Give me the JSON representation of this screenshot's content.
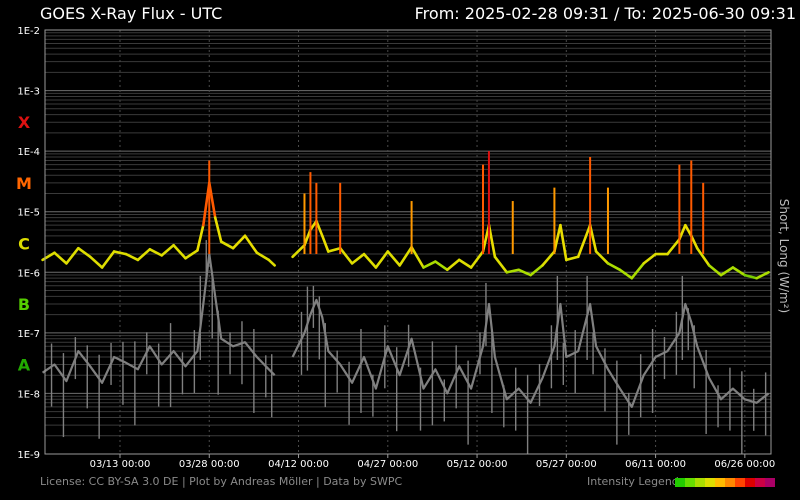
{
  "header": {
    "title": "GOES X-Ray Flux - UTC",
    "range": "From: 2025-02-28 09:31  /  To: 2025-06-30 09:31"
  },
  "footer": {
    "license": "License: CC BY-SA 3.0 DE | Plot by Andreas Möller | Data by SWPC",
    "legend_label": "Intensity Legend",
    "legend_colors": [
      "#22cc00",
      "#66dd00",
      "#aadd00",
      "#dddd00",
      "#ffbb00",
      "#ff8800",
      "#ff4400",
      "#dd0000",
      "#cc0044",
      "#aa0066"
    ]
  },
  "chart_data": {
    "type": "line",
    "title": "GOES X-Ray Flux - UTC",
    "ylabel": "Short, Long (W/m²)",
    "y_scale": "log",
    "ylim": [
      1e-09,
      0.01
    ],
    "y_ticks": [
      {
        "value": 0.01,
        "label": "1E-2"
      },
      {
        "value": 0.001,
        "label": "1E-3"
      },
      {
        "value": 0.0001,
        "label": "1E-4"
      },
      {
        "value": 1e-05,
        "label": "1E-5"
      },
      {
        "value": 1e-06,
        "label": "1E-6"
      },
      {
        "value": 1e-07,
        "label": "1E-7"
      },
      {
        "value": 1e-08,
        "label": "1E-8"
      },
      {
        "value": 1e-09,
        "label": "1E-9"
      }
    ],
    "flare_classes": [
      {
        "label": "X",
        "value": 0.0003,
        "color": "#dd1111"
      },
      {
        "label": "M",
        "value": 3e-05,
        "color": "#ff6600"
      },
      {
        "label": "C",
        "value": 3e-06,
        "color": "#dddd00"
      },
      {
        "label": "B",
        "value": 3e-07,
        "color": "#55cc00"
      },
      {
        "label": "A",
        "value": 3e-08,
        "color": "#22aa00"
      }
    ],
    "xlim": [
      "2025-02-28 09:31",
      "2025-06-30 09:31"
    ],
    "x_ticks": [
      "03/13 00:00",
      "03/28 00:00",
      "04/12 00:00",
      "04/27 00:00",
      "05/12 00:00",
      "05/27 00:00",
      "06/11 00:00",
      "06/26 00:00"
    ],
    "x_tick_dates": [
      "2025-03-13",
      "2025-03-28",
      "2025-04-12",
      "2025-04-27",
      "2025-05-12",
      "2025-05-27",
      "2025-06-11",
      "2025-06-26"
    ],
    "grid": true,
    "series": [
      {
        "color": "#dddd00",
        "points": [
          [
            "2025-02-28",
            1.6e-06
          ],
          [
            "2025-03-02",
            2.1e-06
          ],
          [
            "2025-03-04",
            1.4e-06
          ],
          [
            "2025-03-06",
            2.5e-06
          ],
          [
            "2025-03-08",
            1.8e-06
          ],
          [
            "2025-03-10",
            1.2e-06
          ],
          [
            "2025-03-12",
            2.2e-06
          ],
          [
            "2025-03-14",
            2e-06
          ],
          [
            "2025-03-16",
            1.6e-06
          ],
          [
            "2025-03-18",
            2.4e-06
          ],
          [
            "2025-03-20",
            1.9e-06
          ],
          [
            "2025-03-22",
            2.8e-06
          ],
          [
            "2025-03-24",
            1.7e-06
          ],
          [
            "2025-03-26",
            2.3e-06
          ],
          [
            "2025-03-27",
            6e-06
          ],
          [
            "2025-03-28",
            3e-05
          ],
          [
            "2025-03-29",
            8e-06
          ],
          [
            "2025-03-30",
            3.2e-06
          ],
          [
            "2025-04-01",
            2.5e-06
          ],
          [
            "2025-04-03",
            4e-06
          ],
          [
            "2025-04-05",
            2.1e-06
          ],
          [
            "2025-04-07",
            1.6e-06
          ],
          [
            "2025-04-08",
            1.3e-06
          ],
          [
            "2025-04-09",
            null
          ],
          [
            "2025-04-11",
            1.8e-06
          ],
          [
            "2025-04-13",
            2.8e-06
          ],
          [
            "2025-04-14",
            5e-06
          ],
          [
            "2025-04-15",
            7e-06
          ],
          [
            "2025-04-16",
            4e-06
          ],
          [
            "2025-04-17",
            2.2e-06
          ],
          [
            "2025-04-19",
            2.5e-06
          ],
          [
            "2025-04-21",
            1.4e-06
          ],
          [
            "2025-04-23",
            2e-06
          ],
          [
            "2025-04-25",
            1.2e-06
          ],
          [
            "2025-04-27",
            2.2e-06
          ],
          [
            "2025-04-29",
            1.3e-06
          ],
          [
            "2025-05-01",
            2.6e-06
          ],
          [
            "2025-05-03",
            1.2e-06
          ],
          [
            "2025-05-05",
            1.5e-06
          ],
          [
            "2025-05-07",
            1.1e-06
          ],
          [
            "2025-05-09",
            1.6e-06
          ],
          [
            "2025-05-11",
            1.2e-06
          ],
          [
            "2025-05-13",
            2.2e-06
          ],
          [
            "2025-05-14",
            6e-06
          ],
          [
            "2025-05-15",
            1.8e-06
          ],
          [
            "2025-05-17",
            1e-06
          ],
          [
            "2025-05-19",
            1.1e-06
          ],
          [
            "2025-05-21",
            9e-07
          ],
          [
            "2025-05-23",
            1.3e-06
          ],
          [
            "2025-05-25",
            2.2e-06
          ],
          [
            "2025-05-26",
            6e-06
          ],
          [
            "2025-05-27",
            1.6e-06
          ],
          [
            "2025-05-29",
            1.8e-06
          ],
          [
            "2025-05-31",
            6e-06
          ],
          [
            "2025-06-01",
            2.2e-06
          ],
          [
            "2025-06-03",
            1.4e-06
          ],
          [
            "2025-06-05",
            1.1e-06
          ],
          [
            "2025-06-07",
            8e-07
          ],
          [
            "2025-06-09",
            1.4e-06
          ],
          [
            "2025-06-11",
            2e-06
          ],
          [
            "2025-06-13",
            2e-06
          ],
          [
            "2025-06-15",
            3.5e-06
          ],
          [
            "2025-06-16",
            6e-06
          ],
          [
            "2025-06-17",
            4e-06
          ],
          [
            "2025-06-18",
            2.5e-06
          ],
          [
            "2025-06-20",
            1.3e-06
          ],
          [
            "2025-06-22",
            9e-07
          ],
          [
            "2025-06-24",
            1.2e-06
          ],
          [
            "2025-06-26",
            9e-07
          ],
          [
            "2025-06-28",
            8e-07
          ],
          [
            "2025-06-30",
            1e-06
          ]
        ]
      },
      {
        "color": "#808080",
        "points": [
          [
            "2025-02-28",
            2.2e-08
          ],
          [
            "2025-03-02",
            3e-08
          ],
          [
            "2025-03-04",
            1.6e-08
          ],
          [
            "2025-03-06",
            5e-08
          ],
          [
            "2025-03-08",
            2.8e-08
          ],
          [
            "2025-03-10",
            1.5e-08
          ],
          [
            "2025-03-12",
            4e-08
          ],
          [
            "2025-03-14",
            3.2e-08
          ],
          [
            "2025-03-16",
            2.5e-08
          ],
          [
            "2025-03-18",
            6e-08
          ],
          [
            "2025-03-20",
            3e-08
          ],
          [
            "2025-03-22",
            5e-08
          ],
          [
            "2025-03-24",
            2.8e-08
          ],
          [
            "2025-03-26",
            5e-08
          ],
          [
            "2025-03-27",
            3e-07
          ],
          [
            "2025-03-28",
            2e-06
          ],
          [
            "2025-03-29",
            4e-07
          ],
          [
            "2025-03-30",
            8e-08
          ],
          [
            "2025-04-01",
            6e-08
          ],
          [
            "2025-04-03",
            7e-08
          ],
          [
            "2025-04-05",
            4e-08
          ],
          [
            "2025-04-07",
            2.5e-08
          ],
          [
            "2025-04-08",
            2e-08
          ],
          [
            "2025-04-09",
            null
          ],
          [
            "2025-04-11",
            4e-08
          ],
          [
            "2025-04-13",
            1e-07
          ],
          [
            "2025-04-14",
            2e-07
          ],
          [
            "2025-04-15",
            3.5e-07
          ],
          [
            "2025-04-16",
            1.8e-07
          ],
          [
            "2025-04-17",
            5e-08
          ],
          [
            "2025-04-19",
            3e-08
          ],
          [
            "2025-04-21",
            1.5e-08
          ],
          [
            "2025-04-23",
            4e-08
          ],
          [
            "2025-04-25",
            1.2e-08
          ],
          [
            "2025-04-27",
            6e-08
          ],
          [
            "2025-04-29",
            2e-08
          ],
          [
            "2025-05-01",
            8e-08
          ],
          [
            "2025-05-03",
            1.2e-08
          ],
          [
            "2025-05-05",
            2.5e-08
          ],
          [
            "2025-05-07",
            1e-08
          ],
          [
            "2025-05-09",
            2.8e-08
          ],
          [
            "2025-05-11",
            1.2e-08
          ],
          [
            "2025-05-13",
            6e-08
          ],
          [
            "2025-05-14",
            3e-07
          ],
          [
            "2025-05-15",
            4e-08
          ],
          [
            "2025-05-17",
            8e-09
          ],
          [
            "2025-05-19",
            1.2e-08
          ],
          [
            "2025-05-21",
            7e-09
          ],
          [
            "2025-05-23",
            1.8e-08
          ],
          [
            "2025-05-25",
            6e-08
          ],
          [
            "2025-05-26",
            3e-07
          ],
          [
            "2025-05-27",
            4e-08
          ],
          [
            "2025-05-29",
            5e-08
          ],
          [
            "2025-05-31",
            3e-07
          ],
          [
            "2025-06-01",
            6e-08
          ],
          [
            "2025-06-03",
            2.5e-08
          ],
          [
            "2025-06-05",
            1.2e-08
          ],
          [
            "2025-06-07",
            6e-09
          ],
          [
            "2025-06-09",
            2e-08
          ],
          [
            "2025-06-11",
            4e-08
          ],
          [
            "2025-06-13",
            5e-08
          ],
          [
            "2025-06-15",
            1e-07
          ],
          [
            "2025-06-16",
            3e-07
          ],
          [
            "2025-06-17",
            1.5e-07
          ],
          [
            "2025-06-18",
            6e-08
          ],
          [
            "2025-06-20",
            1.8e-08
          ],
          [
            "2025-06-22",
            8e-09
          ],
          [
            "2025-06-24",
            1.2e-08
          ],
          [
            "2025-06-26",
            8e-09
          ],
          [
            "2025-06-28",
            7e-09
          ],
          [
            "2025-06-30",
            1e-08
          ]
        ]
      }
    ],
    "peaks": [
      {
        "date": "2025-03-28",
        "value": 7e-05
      },
      {
        "date": "2025-04-13",
        "value": 2e-05
      },
      {
        "date": "2025-04-14",
        "value": 4.5e-05
      },
      {
        "date": "2025-04-15",
        "value": 3e-05
      },
      {
        "date": "2025-04-19",
        "value": 3e-05
      },
      {
        "date": "2025-05-01",
        "value": 1.5e-05
      },
      {
        "date": "2025-05-13",
        "value": 6e-05
      },
      {
        "date": "2025-05-14",
        "value": 0.0001
      },
      {
        "date": "2025-05-18",
        "value": 1.5e-05
      },
      {
        "date": "2025-05-25",
        "value": 2.5e-05
      },
      {
        "date": "2025-05-31",
        "value": 8e-05
      },
      {
        "date": "2025-06-03",
        "value": 2.5e-05
      },
      {
        "date": "2025-06-15",
        "value": 6e-05
      },
      {
        "date": "2025-06-17",
        "value": 7e-05
      },
      {
        "date": "2025-06-19",
        "value": 3e-05
      }
    ]
  }
}
